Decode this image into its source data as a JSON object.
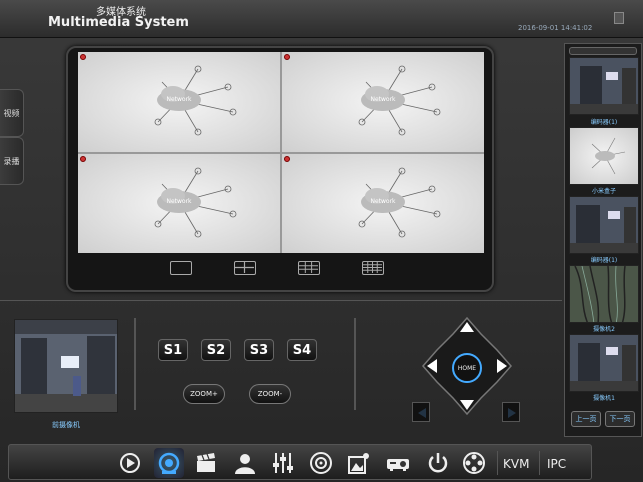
{
  "header": {
    "title_cn": "多媒体系统",
    "title_en": "Multimedia System",
    "datetime": "2016-09-01 14:41:02"
  },
  "side_tabs": [
    {
      "label": "视频"
    },
    {
      "label": "录播"
    }
  ],
  "video_grid": {
    "cells": [
      {
        "label": "Network"
      },
      {
        "label": "Network"
      },
      {
        "label": "Network"
      },
      {
        "label": "Network"
      }
    ],
    "layouts": [
      "1x1",
      "2x2",
      "3x3",
      "4x4"
    ]
  },
  "thumbnails": [
    {
      "label": "编码器(1)"
    },
    {
      "label": "小米盒子"
    },
    {
      "label": "编码器(1)"
    },
    {
      "label": "摄像机2"
    },
    {
      "label": "摄像机1"
    }
  ],
  "pager": {
    "prev": "上一页",
    "next": "下一页"
  },
  "preview": {
    "label": "前摄像机"
  },
  "scene_buttons": [
    "S1",
    "S2",
    "S3",
    "S4"
  ],
  "zoom": {
    "in": "ZOOM+",
    "out": "ZOOM-"
  },
  "ptz": {
    "home": "HOME"
  },
  "toolbar": {
    "icons": [
      "play-icon",
      "camera-icon",
      "clapper-icon",
      "user-icon",
      "sliders-icon",
      "disc-icon",
      "picture-icon",
      "projector-icon",
      "power-icon",
      "film-reel-icon"
    ],
    "kvm_label": "KVM",
    "ipc_label": "IPC"
  },
  "colors": {
    "accent": "#44aaff",
    "label_blue": "#88ccff",
    "record_red": "#cc3333"
  }
}
